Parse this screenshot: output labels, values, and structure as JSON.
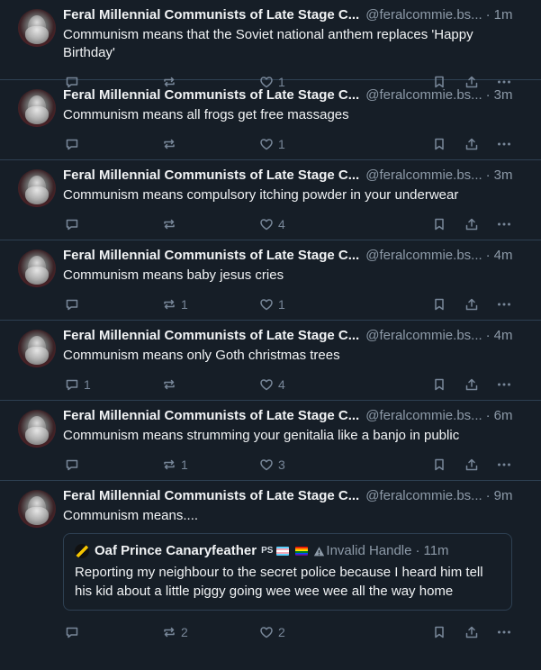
{
  "feed": {
    "posts": [
      {
        "author": "Feral Millennial Communists of Late Stage C...",
        "handle": "@feralcommie.bs...",
        "time": "1m",
        "text": "Communism means that the Soviet national anthem replaces 'Happy Birthday'",
        "replies": "",
        "reposts": "",
        "likes": "1"
      },
      {
        "author": "Feral Millennial Communists of Late Stage C...",
        "handle": "@feralcommie.bs...",
        "time": "3m",
        "text": "Communism means all frogs get free massages",
        "replies": "",
        "reposts": "",
        "likes": "1"
      },
      {
        "author": "Feral Millennial Communists of Late Stage C...",
        "handle": "@feralcommie.bs...",
        "time": "3m",
        "text": "Communism means compulsory itching powder in your underwear",
        "replies": "",
        "reposts": "",
        "likes": "4"
      },
      {
        "author": "Feral Millennial Communists of Late Stage C...",
        "handle": "@feralcommie.bs...",
        "time": "4m",
        "text": "Communism means baby jesus cries",
        "replies": "",
        "reposts": "1",
        "likes": "1"
      },
      {
        "author": "Feral Millennial Communists of Late Stage C...",
        "handle": "@feralcommie.bs...",
        "time": "4m",
        "text": "Communism means only Goth christmas trees",
        "replies": "1",
        "reposts": "",
        "likes": "4"
      },
      {
        "author": "Feral Millennial Communists of Late Stage C...",
        "handle": "@feralcommie.bs...",
        "time": "6m",
        "text": "Communism means strumming your genitalia like a banjo in public",
        "replies": "",
        "reposts": "1",
        "likes": "3"
      },
      {
        "author": "Feral Millennial Communists of Late Stage C...",
        "handle": "@feralcommie.bs...",
        "time": "9m",
        "text": "Communism means....",
        "replies": "",
        "reposts": "2",
        "likes": "2",
        "quote": {
          "author": "Oaf Prince Canaryfeather",
          "badge": "PS",
          "handle_warning": "Invalid Handle",
          "time": "11m",
          "text": "Reporting my neighbour to the secret police because I heard him tell his kid about a little piggy going wee wee wee all the way home"
        }
      }
    ]
  },
  "colors": {
    "background": "#161e27",
    "border": "#2e4052",
    "muted_text": "#8d9aa8",
    "icon": "#788799"
  },
  "icons": {
    "reply": "speech-bubble-icon",
    "repost": "repost-arrows-icon",
    "like": "heart-icon",
    "bookmark": "bookmark-icon",
    "share": "share-icon",
    "more": "ellipsis-icon",
    "warning": "warning-triangle-icon"
  }
}
